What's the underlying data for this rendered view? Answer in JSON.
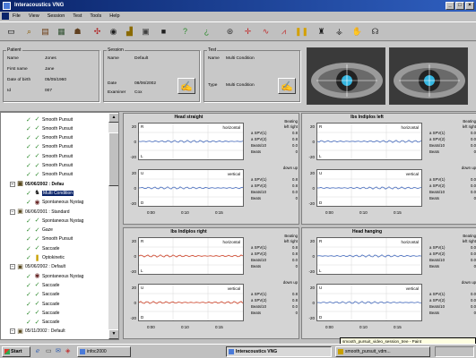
{
  "window": {
    "title": "Interacoustics VNG"
  },
  "menu": [
    "File",
    "View",
    "Session",
    "Test",
    "Tools",
    "Help"
  ],
  "toolbar": [
    "new-icon",
    "search-icon",
    "print-icon",
    "save-icon",
    "user-icon",
    "move-icon",
    "record-icon",
    "chart-icon",
    "help-icon",
    "question-icon",
    "eye-move-icon",
    "crosshair-icon",
    "nystagmus-icon",
    "pursuit-icon",
    "bars-icon",
    "positional-icon",
    "caloric-icon",
    "hand-icon",
    "head-icon"
  ],
  "patient": {
    "group": "Patient",
    "name_label": "Name",
    "name_value": "Jones",
    "first_label": "First name",
    "first_value": "Jane",
    "dob_label": "Date of birth",
    "dob_value": "05/05/1960",
    "id_label": "Id",
    "id_value": "007"
  },
  "session": {
    "group": "Session",
    "name_label": "Name",
    "name_value": "Default",
    "date_label": "Date",
    "date_value": "08/06/2002",
    "examiner_label": "Examiner",
    "examiner_value": "Cox"
  },
  "test": {
    "group": "Test",
    "name_label": "Name",
    "name_value": "Multi Condition",
    "type_label": "Type",
    "type_value": "Multi Condition"
  },
  "tree": [
    {
      "label": "Smooth Pursuit",
      "indent": 28,
      "icon": "check"
    },
    {
      "label": "Smooth Pursuit",
      "indent": 28,
      "icon": "check"
    },
    {
      "label": "Smooth Pursuit",
      "indent": 28,
      "icon": "check"
    },
    {
      "label": "Smooth Pursuit",
      "indent": 28,
      "icon": "check"
    },
    {
      "label": "Smooth Pursuit",
      "indent": 28,
      "icon": "check"
    },
    {
      "label": "Smooth Pursuit",
      "indent": 28,
      "icon": "check"
    },
    {
      "label": "Smooth Pursuit",
      "indent": 28,
      "icon": "check"
    },
    {
      "label": "05/06/2002 : Defau",
      "indent": 10,
      "icon": "folder",
      "bold": true
    },
    {
      "label": "Multi Condition",
      "indent": 28,
      "icon": "run",
      "selected": true
    },
    {
      "label": "Spontaneous Nystag",
      "indent": 28,
      "icon": "eye"
    },
    {
      "label": "06/06/2001 : Standard",
      "indent": 10,
      "icon": "folder"
    },
    {
      "label": "Spontaneous Nystag",
      "indent": 28,
      "icon": "check"
    },
    {
      "label": "Gaze",
      "indent": 28,
      "icon": "check"
    },
    {
      "label": "Smooth Pursuit",
      "indent": 28,
      "icon": "check"
    },
    {
      "label": "Saccade",
      "indent": 28,
      "icon": "check"
    },
    {
      "label": "Optokinetic",
      "indent": 28,
      "icon": "bars"
    },
    {
      "label": "05/06/2002 : Default",
      "indent": 10,
      "icon": "folder"
    },
    {
      "label": "Spontaneous Nystag",
      "indent": 28,
      "icon": "eye"
    },
    {
      "label": "Saccade",
      "indent": 28,
      "icon": "check"
    },
    {
      "label": "Saccade",
      "indent": 28,
      "icon": "check"
    },
    {
      "label": "Saccade",
      "indent": 28,
      "icon": "check"
    },
    {
      "label": "Saccade",
      "indent": 28,
      "icon": "check"
    },
    {
      "label": "Saccade",
      "indent": 28,
      "icon": "check"
    },
    {
      "label": "05/11/2002 : Default",
      "indent": 10,
      "icon": "folder"
    }
  ],
  "charts": [
    {
      "title": "Head straight",
      "traces": [
        "horizontal",
        "vertical"
      ],
      "color": "#4a6fc0",
      "stats_top": {
        "head": "Beating",
        "cols": "left right",
        "rows": [
          [
            "a SPV(1)",
            "0.8"
          ],
          [
            "a SPV(2)",
            "0.8"
          ],
          [
            "Beats/10",
            "0.0"
          ],
          [
            "Beats",
            "0"
          ]
        ]
      },
      "stats_bot": {
        "head": "down up",
        "rows": [
          [
            "a SPV(1)",
            "0.8"
          ],
          [
            "a SPV(2)",
            "0.8"
          ],
          [
            "Beats/10",
            "0.0"
          ],
          [
            "Beats",
            "0"
          ]
        ]
      }
    },
    {
      "title": "Ibs Indiplos left",
      "traces": [
        "horizontal",
        "vertical"
      ],
      "color": "#4a6fc0",
      "stats_top": {
        "head": "Beating",
        "cols": "left right",
        "rows": [
          [
            "a SPV(1)",
            "0.0"
          ],
          [
            "a SPV(2)",
            "0.0"
          ],
          [
            "Beats/10",
            "0.0"
          ],
          [
            "Beats",
            "0"
          ]
        ]
      },
      "stats_bot": {
        "head": "down up",
        "rows": [
          [
            "a SPV(1)",
            "0.0"
          ],
          [
            "a SPV(2)",
            "0.0"
          ],
          [
            "Beats/10",
            "0.0"
          ],
          [
            "Beats",
            "0"
          ]
        ]
      }
    },
    {
      "title": "Ibs Indiplos right",
      "traces": [
        "horizontal",
        "vertical"
      ],
      "color": "#d0442a",
      "stats_top": {
        "head": "Beating",
        "cols": "left right",
        "rows": [
          [
            "a SPV(1)",
            "0.8"
          ],
          [
            "a SPV(2)",
            "0.8"
          ],
          [
            "Beats/10",
            "0.0"
          ],
          [
            "Beats",
            "0"
          ]
        ]
      },
      "stats_bot": {
        "head": "down up",
        "rows": [
          [
            "a SPV(1)",
            "0.8"
          ],
          [
            "a SPV(2)",
            "0.8"
          ],
          [
            "Beats/10",
            "0.0"
          ],
          [
            "Beats",
            "0"
          ]
        ]
      }
    },
    {
      "title": "Head hanging",
      "traces": [
        "horizontal",
        "vertical"
      ],
      "color": "#4a6fc0",
      "stats_top": {
        "head": "Beating",
        "cols": "left right",
        "rows": [
          [
            "a SPV(1)",
            "0.0"
          ],
          [
            "a SPV(2)",
            "0.0"
          ],
          [
            "Beats/10",
            "0.0"
          ],
          [
            "Beats",
            "0"
          ]
        ]
      },
      "stats_bot": {
        "head": "down up",
        "rows": [
          [
            "a SPV(1)",
            "0.0"
          ],
          [
            "a SPV(2)",
            "0.0"
          ],
          [
            "Beats/10",
            "0.0"
          ],
          [
            "Beats",
            "0"
          ]
        ]
      }
    }
  ],
  "chart_axes": {
    "yticks": [
      "20",
      "0",
      "-20"
    ],
    "xticks": [
      "0:00",
      "0:10",
      "0:15"
    ],
    "up_label": "U",
    "down_label": "D",
    "left_label": "L"
  },
  "taskbar": {
    "start": "Start",
    "tasks": [
      "infoc2000",
      "Interacoustics VNG",
      "smooth_pursuit_vdm..."
    ],
    "tooltip": "smooth_pursuit_video_session_tree - Paint"
  }
}
